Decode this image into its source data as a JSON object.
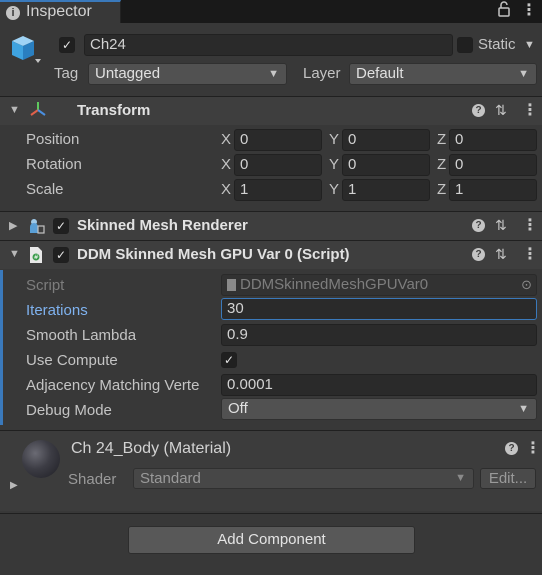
{
  "tab": {
    "title": "Inspector"
  },
  "header": {
    "object_name": "Ch24",
    "active": true,
    "static_label": "Static",
    "static_checked": false,
    "tag_label": "Tag",
    "tag_value": "Untagged",
    "layer_label": "Layer",
    "layer_value": "Default"
  },
  "transform": {
    "title": "Transform",
    "rows": [
      {
        "label": "Position",
        "x": "0",
        "y": "0",
        "z": "0"
      },
      {
        "label": "Rotation",
        "x": "0",
        "y": "0",
        "z": "0"
      },
      {
        "label": "Scale",
        "x": "1",
        "y": "1",
        "z": "1"
      }
    ],
    "axes": {
      "x": "X",
      "y": "Y",
      "z": "Z"
    }
  },
  "skinned_mesh_renderer": {
    "title": "Skinned Mesh Renderer",
    "enabled": true
  },
  "ddm": {
    "title": "DDM Skinned Mesh GPU Var 0 (Script)",
    "enabled": true,
    "script_label": "Script",
    "script_value": "DDMSkinnedMeshGPUVar0",
    "iterations_label": "Iterations",
    "iterations_value": "30",
    "smooth_lambda_label": "Smooth Lambda",
    "smooth_lambda_value": "0.9",
    "use_compute_label": "Use Compute",
    "use_compute_checked": true,
    "adjacency_label": "Adjacency Matching Verte",
    "adjacency_value": "0.0001",
    "debug_mode_label": "Debug Mode",
    "debug_mode_value": "Off"
  },
  "material": {
    "title": "Ch 24_Body (Material)",
    "shader_label": "Shader",
    "shader_value": "Standard",
    "edit_label": "Edit..."
  },
  "add_component_label": "Add Component",
  "icons": {
    "check": "✓",
    "help": "?",
    "kebab": "⋮",
    "caret_down": "▼",
    "caret_right": "▶",
    "presets": "⇅",
    "lock": "🔒"
  }
}
